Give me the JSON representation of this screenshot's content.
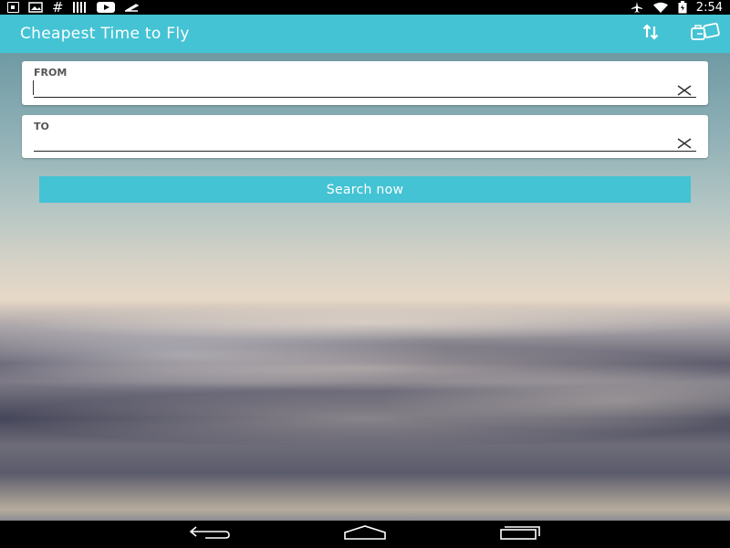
{
  "status_bar": {
    "time": "2:54",
    "left_icons": [
      "download-icon",
      "image-icon",
      "hashtag-icon",
      "barcode-icon",
      "youtube-icon",
      "flight-icon"
    ],
    "right_icons": [
      "airplane-mode-icon",
      "wifi-icon",
      "battery-icon"
    ]
  },
  "app_bar": {
    "title": "Cheapest Time to Fly",
    "actions": [
      "swap-icon",
      "luggage-icon"
    ]
  },
  "form": {
    "from": {
      "label": "FROM",
      "value": "",
      "placeholder": ""
    },
    "to": {
      "label": "TO",
      "value": "",
      "placeholder": ""
    },
    "search_label": "Search now"
  },
  "nav_bar": {
    "buttons": [
      "back-icon",
      "home-icon",
      "recent-apps-icon"
    ]
  },
  "colors": {
    "accent": "#44c3d4",
    "status_bar": "#000000",
    "nav_bar": "#000000",
    "card": "#ffffff"
  }
}
